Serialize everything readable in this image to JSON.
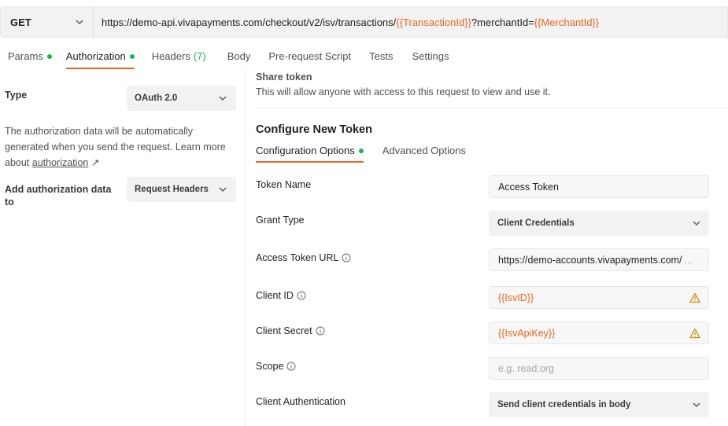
{
  "request": {
    "method": "GET",
    "url_base": "https://demo-api.vivapayments.com/checkout/v2/isv/transactions/",
    "url_var1": "{{TransactionId}}",
    "url_mid": "?merchantId=",
    "url_var2": "{{MerchantId}}"
  },
  "tabs": [
    {
      "label": "Params",
      "dot": true
    },
    {
      "label": "Authorization",
      "dot": true,
      "active": true
    },
    {
      "label": "Headers",
      "count": "(7)"
    },
    {
      "label": "Body"
    },
    {
      "label": "Pre-request Script"
    },
    {
      "label": "Tests"
    },
    {
      "label": "Settings"
    }
  ],
  "left": {
    "type_label": "Type",
    "type_value": "OAuth 2.0",
    "description_pre": "The authorization data will be automatically generated when you send the request. Learn more about ",
    "description_link": "authorization",
    "description_arrow": "↗",
    "add_label": "Add authorization data to",
    "add_value": "Request Headers"
  },
  "share": {
    "title": "Share token",
    "description": "This will allow anyone with access to this request to view and use it."
  },
  "configure": {
    "title": "Configure New Token",
    "subtabs": [
      {
        "label": "Configuration Options",
        "dot": true,
        "active": true
      },
      {
        "label": "Advanced Options"
      }
    ],
    "rows": {
      "token_name": {
        "label": "Token Name",
        "value": "Access Token"
      },
      "grant_type": {
        "label": "Grant Type",
        "value": "Client Credentials"
      },
      "access_token_url": {
        "label": "Access Token URL",
        "value": "https://demo-accounts.vivapayments.com/",
        "ellipsis": "..."
      },
      "client_id": {
        "label": "Client ID",
        "value": "{{IsvID}}"
      },
      "client_secret": {
        "label": "Client Secret",
        "value": "{{IsvApiKey}}"
      },
      "scope": {
        "label": "Scope",
        "placeholder": "e.g. read:org"
      },
      "client_auth": {
        "label": "Client Authentication",
        "value": "Send client credentials in body"
      }
    }
  },
  "colors": {
    "accent": "#e8671f",
    "green_dot": "#0cbb52",
    "warning": "#d9a300"
  }
}
